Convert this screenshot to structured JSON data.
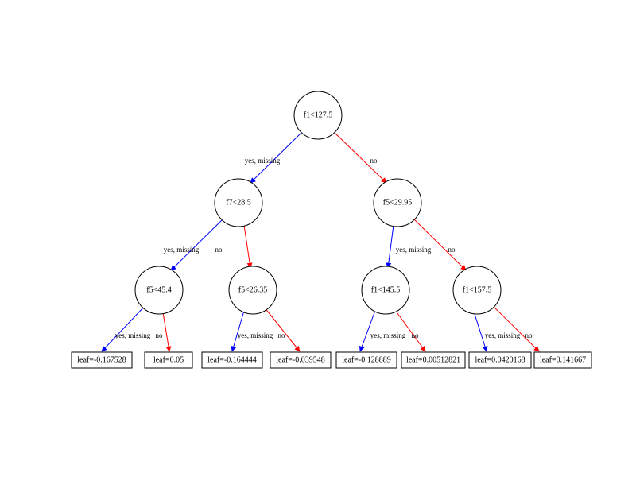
{
  "tree": {
    "root": {
      "label": "f1<127.5",
      "yes_edge": "yes, missing",
      "no_edge": "no"
    },
    "level1_left": {
      "label": "f7<28.5",
      "yes_edge": "yes, missing",
      "no_edge": "no"
    },
    "level1_right": {
      "label": "f5<29.95",
      "yes_edge": "yes, missing",
      "no_edge": "no"
    },
    "level2_0": {
      "label": "f5<45.4",
      "yes_edge": "yes, missing",
      "no_edge": "no"
    },
    "level2_1": {
      "label": "f5<26.35",
      "yes_edge": "yes, missing",
      "no_edge": "no"
    },
    "level2_2": {
      "label": "f1<145.5",
      "yes_edge": "yes, missing",
      "no_edge": "no"
    },
    "level2_3": {
      "label": "f1<157.5",
      "yes_edge": "yes, missing",
      "no_edge": "no"
    },
    "leaves": [
      "leaf=-0.167528",
      "leaf=0.05",
      "leaf=-0.164444",
      "leaf=-0.039548",
      "leaf=-0.128889",
      "leaf=0.00512821",
      "leaf=0.0420168",
      "leaf=0.141667"
    ]
  }
}
